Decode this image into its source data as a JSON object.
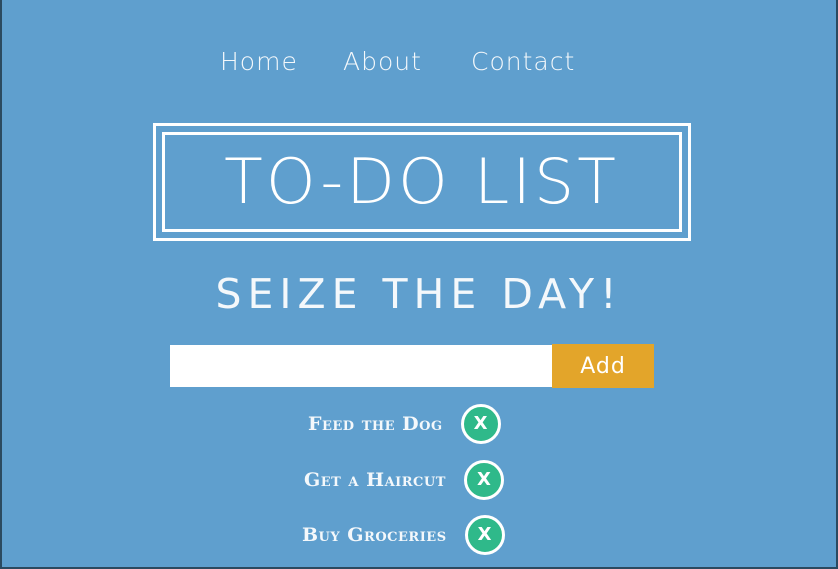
{
  "nav": {
    "items": [
      {
        "label": "Home"
      },
      {
        "label": "About"
      },
      {
        "label": "Contact"
      }
    ]
  },
  "header": {
    "title": "TO-DO LIST",
    "tagline": "SEIZE THE DAY!"
  },
  "add_form": {
    "input_value": "",
    "button_label": "Add"
  },
  "todos": [
    {
      "label": "Feed the Dog",
      "delete_label": "X"
    },
    {
      "label": "Get a Haircut",
      "delete_label": "X"
    },
    {
      "label": "Buy Groceries",
      "delete_label": "X"
    }
  ],
  "colors": {
    "background": "#5f9fce",
    "add_button": "#e3a52a",
    "delete_button": "#2fb98a",
    "text": "#ffffff"
  }
}
